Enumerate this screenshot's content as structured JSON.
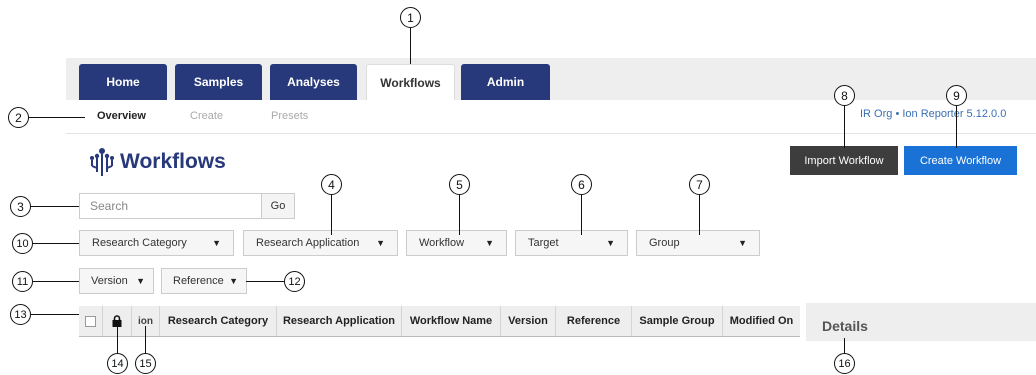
{
  "tabs": {
    "home": "Home",
    "samples": "Samples",
    "analyses": "Analyses",
    "workflows": "Workflows",
    "admin": "Admin"
  },
  "subnav": {
    "overview": "Overview",
    "create": "Create",
    "presets": "Presets"
  },
  "header": {
    "version_info": "IR Org • Ion Reporter  5.12.0.0",
    "title": "Workflows",
    "import_button": "Import Workflow",
    "create_button": "Create Workflow"
  },
  "search": {
    "placeholder": "Search",
    "go_label": "Go"
  },
  "filters": {
    "research_category": "Research Category",
    "research_application": "Research Application",
    "workflow": "Workflow",
    "target": "Target",
    "group": "Group",
    "version": "Version",
    "reference": "Reference"
  },
  "table": {
    "columns": {
      "ion": "ion",
      "research_category": "Research Category",
      "research_application": "Research Application",
      "workflow_name": "Workflow Name",
      "version": "Version",
      "reference": "Reference",
      "sample_group": "Sample Group",
      "modified_on": "Modified On"
    }
  },
  "details": {
    "title": "Details"
  },
  "callouts": [
    "1",
    "2",
    "3",
    "4",
    "5",
    "6",
    "7",
    "8",
    "9",
    "10",
    "11",
    "12",
    "13",
    "14",
    "15",
    "16"
  ],
  "colors": {
    "nav_blue": "#27397a",
    "import_gray": "#3d3d3d",
    "create_blue": "#1a72d6",
    "link_blue": "#3b6fb6"
  }
}
